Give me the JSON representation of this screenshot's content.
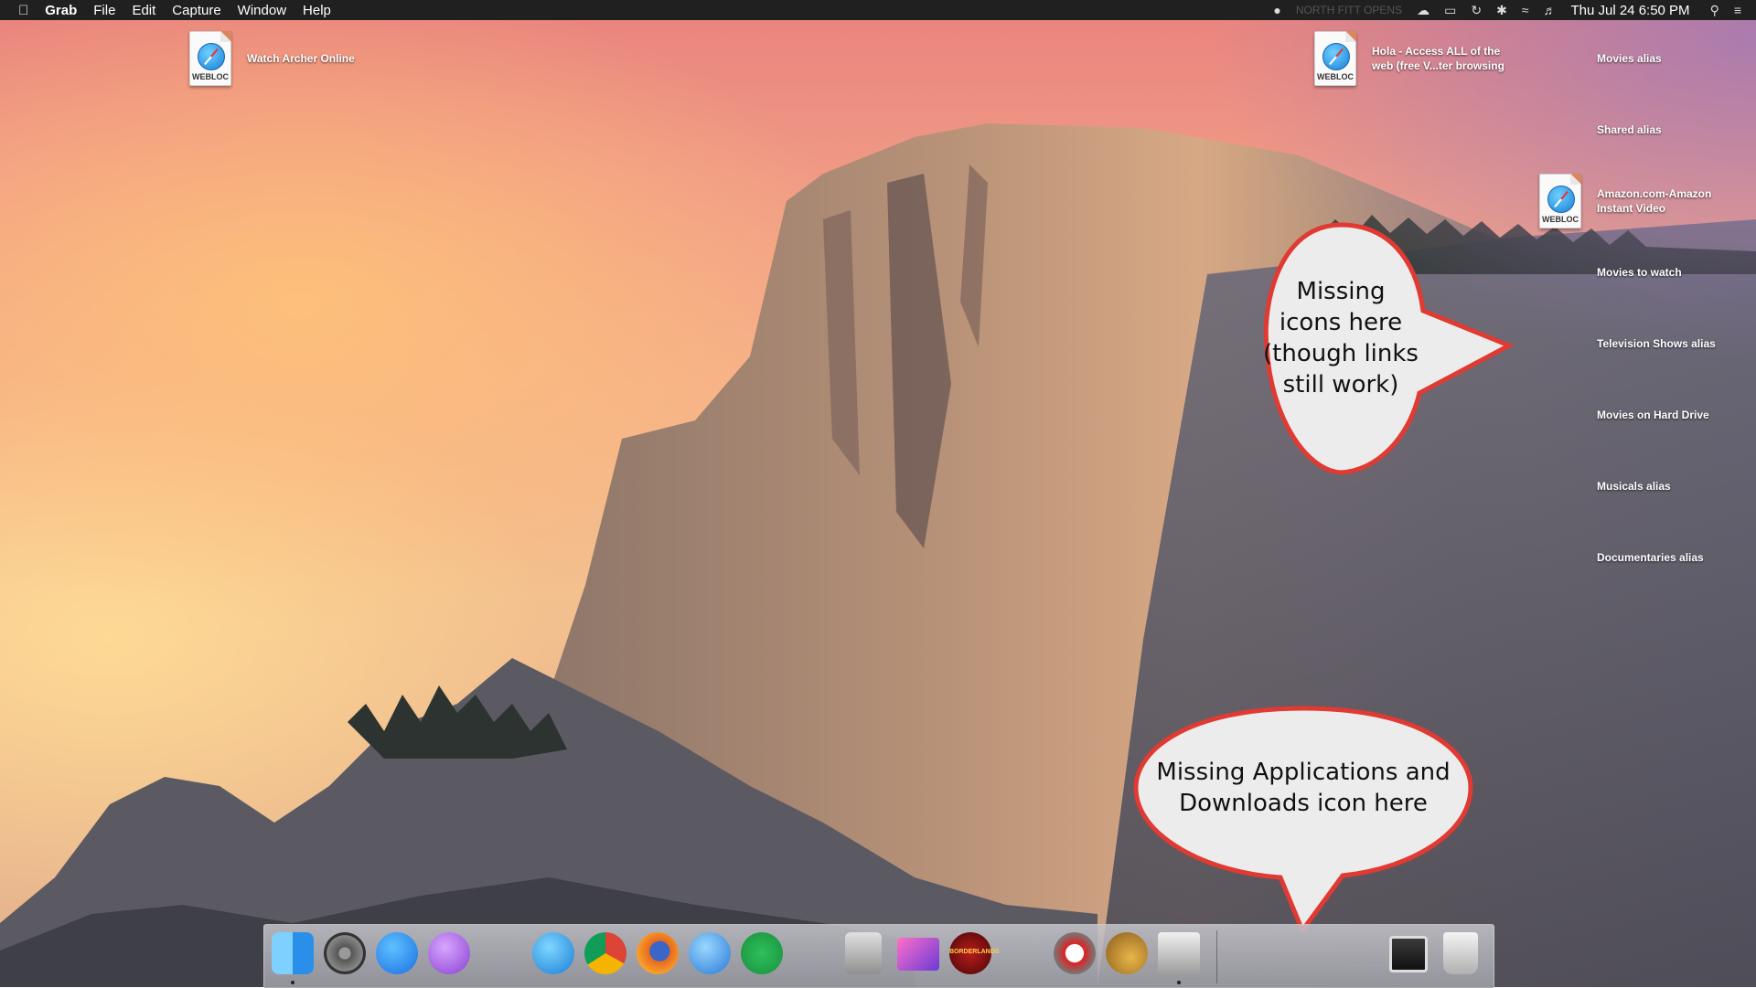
{
  "menubar": {
    "apple": "",
    "app": "Grab",
    "menus": [
      "File",
      "Edit",
      "Capture",
      "Window",
      "Help"
    ],
    "status_faded": "NORTH FITT OPENS",
    "clock": "Thu Jul 24  6:50 PM"
  },
  "desktop": {
    "webloc_tag": "WEBLOC",
    "items": {
      "watch_archer": "Watch Archer Online",
      "hola_line1": "Hola - Access ALL of the",
      "hola_line2": "web (free V...ter browsing",
      "movies_alias": "Movies alias",
      "shared_alias": "Shared alias",
      "amazon_line1": "Amazon.com-Amazon",
      "amazon_line2": "Instant Video",
      "movies_to_watch": "Movies to watch",
      "tv_alias": "Television Shows alias",
      "movies_hd": "Movies on Hard Drive",
      "musicals_alias": "Musicals alias",
      "documentaries_alias": "Documentaries alias"
    }
  },
  "callouts": {
    "icons": [
      "Missing",
      "icons here",
      "(though links",
      "still work)"
    ],
    "dock": [
      "Missing Applications and",
      "Downloads icon here"
    ]
  },
  "dock": {
    "icons": [
      "finder",
      "system-preferences",
      "app-store",
      "feedback-assistant",
      "safari",
      "chrome",
      "firefox",
      "itunes",
      "spotify",
      "dvd-player",
      "imac",
      "borderlands",
      "pirate-game",
      "cocktail",
      "grab",
      "screen",
      "trash"
    ],
    "borderlands_label": "BORDERLANDS"
  }
}
